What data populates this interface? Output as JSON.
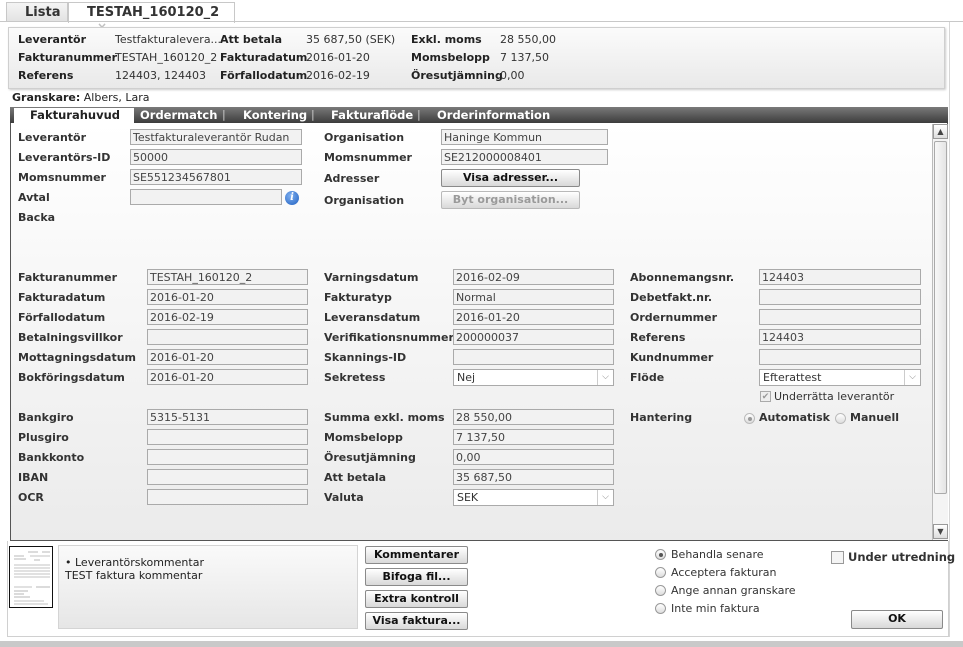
{
  "top_tabs": [
    {
      "label": "Lista",
      "active": false
    },
    {
      "label": "TESTAH_160120_2",
      "active": true,
      "close_icon": "×"
    }
  ],
  "summary": {
    "col1": [
      {
        "label": "Leverantör",
        "value": "Testfakturalevera..."
      },
      {
        "label": "Fakturanummer",
        "value": "TESTAH_160120_2"
      },
      {
        "label": "Referens",
        "value": "124403, 124403"
      }
    ],
    "col2": [
      {
        "label": "Att betala",
        "value": "35 687,50 (SEK)"
      },
      {
        "label": "Fakturadatum",
        "value": "2016-01-20"
      },
      {
        "label": "Förfallodatum",
        "value": "2016-02-19"
      }
    ],
    "col3": [
      {
        "label": "Exkl. moms",
        "value": "28 550,00"
      },
      {
        "label": "Momsbelopp",
        "value": "7 137,50"
      },
      {
        "label": "Öresutjämning",
        "value": "0,00"
      }
    ]
  },
  "granskare": {
    "label": "Granskare:",
    "value": "Albers, Lara"
  },
  "tabs": [
    {
      "label": "Fakturahuvud",
      "active": true
    },
    {
      "label": "Ordermatch",
      "active": false
    },
    {
      "label": "Kontering",
      "active": false
    },
    {
      "label": "Fakturaflöde",
      "active": false
    },
    {
      "label": "Orderinformation",
      "active": false
    }
  ],
  "tab_separator": "|",
  "supplier": {
    "leverantor": {
      "label": "Leverantör",
      "value": "Testfakturaleverantör Rudan"
    },
    "leverantors_id": {
      "label": "Leverantörs-ID",
      "value": "50000"
    },
    "momsnummer": {
      "label": "Momsnummer",
      "value": "SE551234567801"
    },
    "avtal": {
      "label": "Avtal",
      "value": "",
      "info_icon": "i"
    },
    "backa": {
      "label": "Backa"
    }
  },
  "org": {
    "organisation": {
      "label": "Organisation",
      "value": "Haninge Kommun"
    },
    "momsnummer": {
      "label": "Momsnummer",
      "value": "SE212000008401"
    },
    "adresser": {
      "label": "Adresser",
      "button": "Visa adresser..."
    },
    "organisation2": {
      "label": "Organisation",
      "button": "Byt organisation..."
    }
  },
  "invoice_col1": [
    {
      "label": "Fakturanummer",
      "value": "TESTAH_160120_2"
    },
    {
      "label": "Fakturadatum",
      "value": "2016-01-20"
    },
    {
      "label": "Förfallodatum",
      "value": "2016-02-19"
    },
    {
      "label": "Betalningsvillkor",
      "value": ""
    },
    {
      "label": "Mottagningsdatum",
      "value": "2016-01-20"
    },
    {
      "label": "Bokföringsdatum",
      "value": "2016-01-20"
    }
  ],
  "invoice_col2": [
    {
      "label": "Varningsdatum",
      "value": "2016-02-09"
    },
    {
      "label": "Fakturatyp",
      "value": "Normal"
    },
    {
      "label": "Leveransdatum",
      "value": "2016-01-20"
    },
    {
      "label": "Verifikationsnummer",
      "value": "200000037"
    },
    {
      "label": "Skannings-ID",
      "value": ""
    },
    {
      "label": "Sekretess",
      "value": "Nej"
    }
  ],
  "invoice_col3": [
    {
      "label": "Abonnemangsnr.",
      "value": "124403"
    },
    {
      "label": "Debetfakt.nr.",
      "value": ""
    },
    {
      "label": "Ordernummer",
      "value": ""
    },
    {
      "label": "Referens",
      "value": "124403"
    },
    {
      "label": "Kundnummer",
      "value": ""
    },
    {
      "label": "Flöde",
      "value": "Efterattest"
    }
  ],
  "underratta": {
    "label": "Underrätta leverantör",
    "checked": true,
    "disabled": true
  },
  "hantering": {
    "label": "Hantering",
    "options": [
      "Automatisk",
      "Manuell"
    ],
    "selected": "Automatisk"
  },
  "payment_col1": [
    {
      "label": "Bankgiro",
      "value": "5315-5131"
    },
    {
      "label": "Plusgiro",
      "value": ""
    },
    {
      "label": "Bankkonto",
      "value": ""
    },
    {
      "label": "IBAN",
      "value": ""
    },
    {
      "label": "OCR",
      "value": ""
    }
  ],
  "payment_col2": [
    {
      "label": "Summa exkl. moms",
      "value": "28 550,00"
    },
    {
      "label": "Momsbelopp",
      "value": "7 137,50"
    },
    {
      "label": "Öresutjämning",
      "value": "0,00"
    },
    {
      "label": "Att betala",
      "value": "35 687,50"
    },
    {
      "label": "Valuta",
      "value": "SEK"
    }
  ],
  "dropdown_arrow": "⌵",
  "scroll": {
    "up": "▲",
    "down": "▼"
  },
  "comments": {
    "bullet": "•",
    "title": "Leverantörskommentar",
    "text": "TEST faktura kommentar"
  },
  "action_buttons": [
    "Kommentarer",
    "Bifoga fil...",
    "Extra kontroll",
    "Visa faktura..."
  ],
  "decision": {
    "options": [
      "Behandla senare",
      "Acceptera fakturan",
      "Ange annan granskare",
      "Inte min faktura"
    ],
    "selected": "Behandla senare"
  },
  "under_utredning": {
    "label": "Under utredning",
    "checked": false
  },
  "ok_button": "OK"
}
